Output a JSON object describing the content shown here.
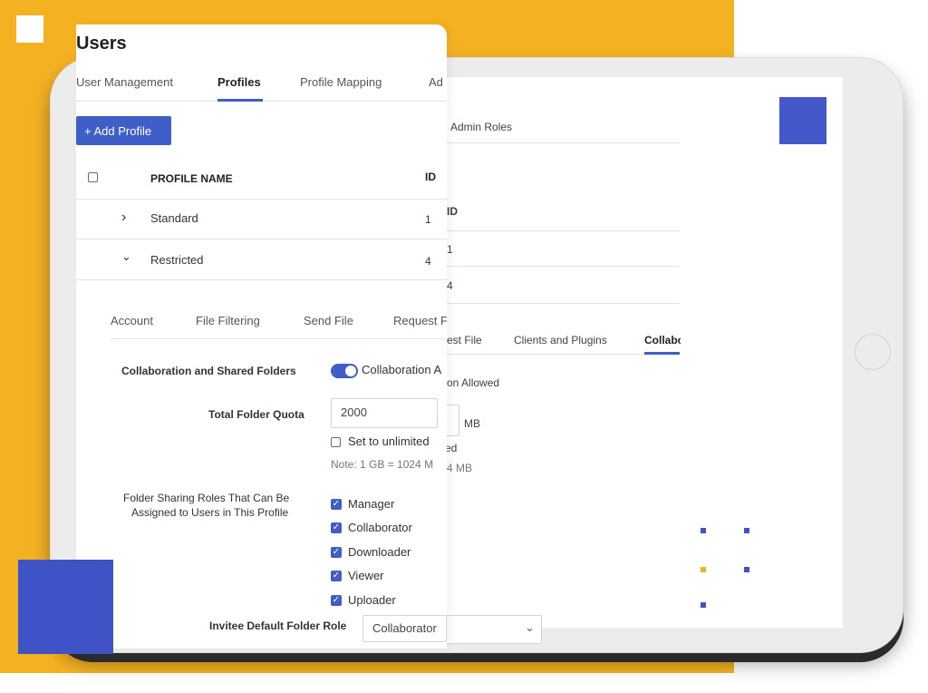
{
  "users": {
    "title": "Users",
    "tabs": [
      "User Management",
      "Profiles",
      "Profile Mapping",
      "Ad"
    ],
    "add_profile": "+ Add Profile",
    "table": {
      "col_name": "PROFILE NAME",
      "col_id": "ID",
      "rows": [
        {
          "name": "Standard",
          "id": "1"
        },
        {
          "name": "Restricted",
          "id": "4"
        }
      ]
    },
    "subtabs": [
      "Account",
      "File Filtering",
      "Send File",
      "Request F"
    ],
    "collab": {
      "label": "Collaboration and Shared Folders",
      "toggle_text": "Collaboration A"
    },
    "quota": {
      "label": "Total Folder Quota",
      "value": "2000",
      "unlimited_label": "Set to unlimited",
      "note": "Note: 1 GB = 1024 M"
    },
    "roles": {
      "label_line1": "Folder Sharing Roles That Can Be",
      "label_line2": "Assigned to Users in This Profile",
      "items": [
        "Manager",
        "Collaborator",
        "Downloader",
        "Viewer",
        "Uploader"
      ]
    },
    "invitee_partial": "Invitee Default Folder Role",
    "invitee_value": "Collaborator"
  },
  "background_screen": {
    "admin_roles": "Admin Roles",
    "id_header": "ID",
    "id_values": [
      "1",
      "4"
    ],
    "tabs": [
      "est File",
      "Clients and Plugins",
      "Collabo"
    ],
    "allowed_text": "on Allowed",
    "mb_label": "MB",
    "ed_text": "ed",
    "mb_note": "4 MB"
  },
  "colors": {
    "accent_blue": "#3f5ec8",
    "brand_yellow": "#f4b223"
  }
}
